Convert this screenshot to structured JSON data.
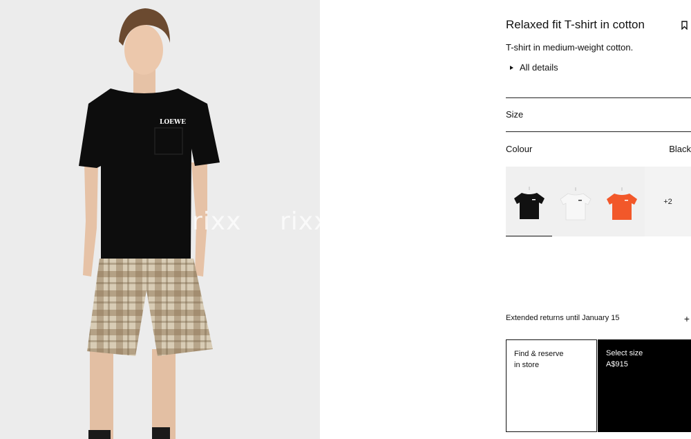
{
  "product": {
    "title": "Relaxed fit T-shirt in cotton",
    "description": "T-shirt in medium-weight cotton.",
    "details_label": "All details",
    "brand_print": "LOEWE"
  },
  "watermark": [
    "rixx",
    "rixx"
  ],
  "size": {
    "label": "Size"
  },
  "colour": {
    "label": "Colour",
    "value": "Black",
    "swatches": [
      {
        "name": "Black",
        "color": "#111111",
        "selected": true
      },
      {
        "name": "White",
        "color": "#f4f4f4",
        "selected": false
      },
      {
        "name": "Orange",
        "color": "#f2582a",
        "selected": false
      }
    ],
    "more_label": "+2"
  },
  "returns": {
    "label": "Extended returns until January 15"
  },
  "actions": {
    "find_line1": "Find & reserve",
    "find_line2": "in store",
    "select_label": "Select size",
    "price": "A$915"
  }
}
